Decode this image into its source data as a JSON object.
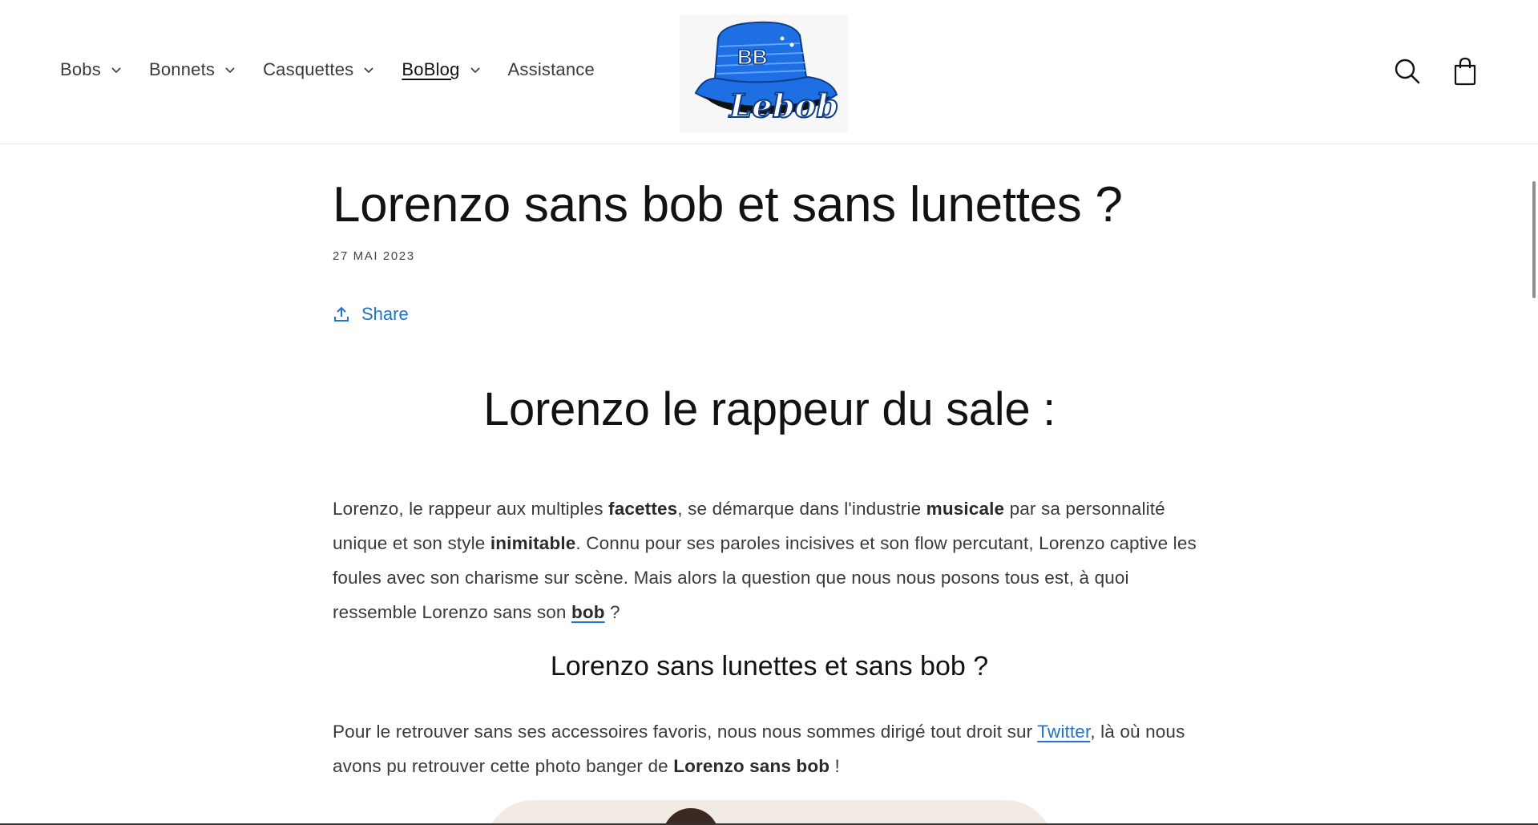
{
  "nav": {
    "items": [
      {
        "label": "Bobs",
        "has_dropdown": true
      },
      {
        "label": "Bonnets",
        "has_dropdown": true
      },
      {
        "label": "Casquettes",
        "has_dropdown": true
      },
      {
        "label": "BoBlog",
        "has_dropdown": true,
        "active": true
      },
      {
        "label": "Assistance",
        "has_dropdown": false
      }
    ]
  },
  "logo": {
    "hat_text": "BB",
    "script_text": "Lebob",
    "color": "#1d6fe3"
  },
  "header_icons": [
    "search-icon",
    "cart-icon"
  ],
  "article": {
    "title": "Lorenzo sans bob et sans lunettes ?",
    "date": "27 MAI 2023",
    "share_label": "Share",
    "h2": "Lorenzo le rappeur du sale :",
    "p1": {
      "t1": "Lorenzo, le rappeur aux multiples ",
      "b1": "facettes",
      "t2": ", se démarque dans l'industrie ",
      "b2": "musicale",
      "t3": " par sa personnalité unique et son style ",
      "b3": "inimitable",
      "t4": ". Connu pour ses paroles incisives et son flow percutant, Lorenzo captive les foules avec son charisme sur scène. Mais alors la question que nous nous posons tous est, à quoi ressemble Lorenzo sans son ",
      "link": "bob",
      "t5": " ?"
    },
    "h3": "Lorenzo sans lunettes et sans bob ?",
    "p2": {
      "t1": "Pour le retrouver sans ses accessoires favoris, nous nous sommes dirigé tout droit sur ",
      "link": "Twitter",
      "t2": ", là où nous avons pu retrouver cette photo banger de ",
      "b1": "Lorenzo sans bob",
      "t3": " !"
    }
  },
  "colors": {
    "link": "#1f73c9",
    "text": "#3a3a3a",
    "heading": "#121212"
  }
}
